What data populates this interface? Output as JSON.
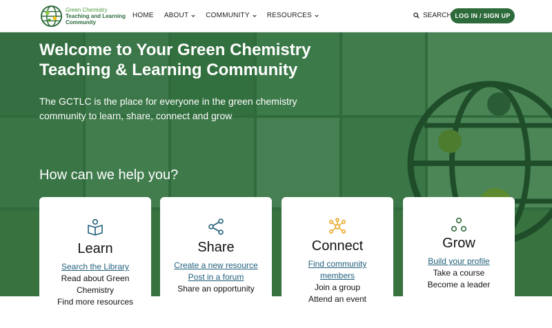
{
  "header": {
    "logo_line1": "Green Chemistry",
    "logo_line2": "Teaching and Learning",
    "logo_line3": "Community",
    "nav": [
      {
        "label": "HOME"
      },
      {
        "label": "ABOUT"
      },
      {
        "label": "COMMUNITY"
      },
      {
        "label": "RESOURCES"
      }
    ],
    "search_label": "SEARCH",
    "login_label": "LOG IN / SIGN UP"
  },
  "hero": {
    "title": "Welcome to Your Green Chemistry Teaching & Learning Community",
    "subtitle": "The GCTLC is the place for everyone in the green chemistry community to learn, share, connect and grow",
    "help_title": "How can we help you?"
  },
  "cards": [
    {
      "title": "Learn",
      "icon": "book-reader-icon",
      "links": [
        "Search the Library"
      ],
      "lines": [
        "Read about Green Chemistry",
        "Find more resources"
      ]
    },
    {
      "title": "Share",
      "icon": "share-icon",
      "links": [
        "Create a new resource",
        "Post in a forum"
      ],
      "lines": [
        "Share an opportunity"
      ]
    },
    {
      "title": "Connect",
      "icon": "network-icon",
      "links": [
        "Find community members"
      ],
      "lines": [
        "Join a group",
        "Attend an event"
      ]
    },
    {
      "title": "Grow",
      "icon": "growth-icon",
      "links": [
        "Build your profile"
      ],
      "lines": [
        "Take a course",
        "Become a leader"
      ]
    }
  ],
  "colors": {
    "brand_green": "#2e6b3b",
    "hero_green": "#2f6b3d",
    "link_blue": "#1f5e7a",
    "connect_orange": "#e8a21a"
  }
}
